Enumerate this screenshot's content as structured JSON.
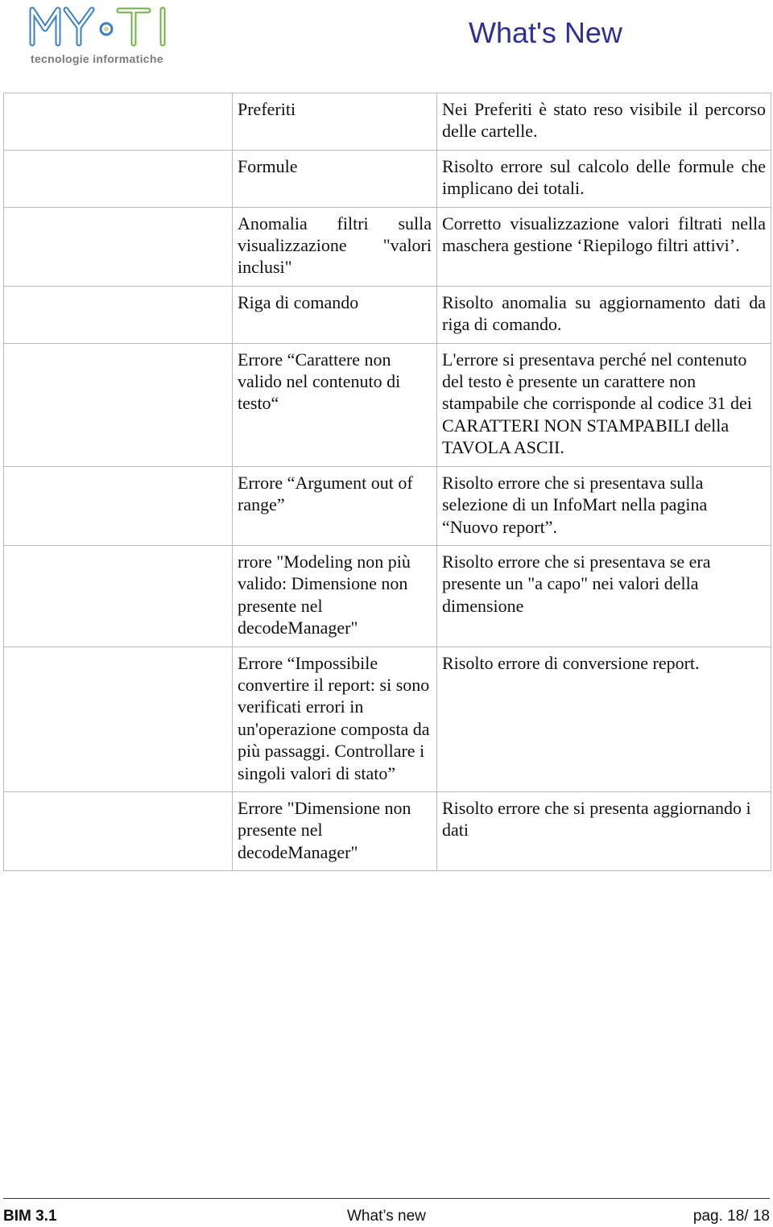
{
  "header": {
    "logo_text_left": "MY",
    "logo_text_right": "TI",
    "logo_subtitle": "tecnologie informatiche",
    "title": "What's New",
    "title_color": "#2e3192",
    "logo_blue": "#3a7fc4",
    "logo_green": "#6db33f"
  },
  "table": {
    "rows": [
      {
        "category": "",
        "issue": "Preferiti",
        "resolution": "Nei Preferiti è stato reso visibile il percorso delle cartelle.",
        "justify": true
      },
      {
        "category": "",
        "issue": "Formule",
        "resolution": "Risolto errore sul calcolo delle formule che implicano dei totali.",
        "justify": true
      },
      {
        "category": "",
        "issue": "Anomalia filtri sulla visualizzazione \"valori inclusi\"",
        "resolution": "Corretto visualizzazione valori filtrati nella maschera gestione ‘Riepilogo filtri attivi’.",
        "justify": true
      },
      {
        "category": "",
        "issue": "Riga di comando",
        "resolution": "Risolto anomalia su aggiornamento dati da riga di comando.",
        "justify": true
      },
      {
        "category": "",
        "issue": "Errore “Carattere non valido nel contenuto di testo“",
        "resolution": "L'errore si presentava perché nel contenuto del testo è presente un carattere non stampabile che corrisponde al codice 31 dei CARATTERI NON STAMPABILI della TAVOLA ASCII.",
        "justify": false
      },
      {
        "category": "",
        "issue": "Errore “Argument out of range”",
        "resolution": "Risolto errore che si presentava sulla selezione di un InfoMart nella pagina “Nuovo report”.",
        "justify": false
      },
      {
        "category": "",
        "issue": "rrore \"Modeling non più valido: Dimensione non presente nel decodeManager\"",
        "resolution": "Risolto errore che si presentava se era presente un \"a capo\" nei valori della dimensione",
        "justify": false
      },
      {
        "category": "",
        "issue": "Errore “Impossibile convertire il report: si sono verificati errori in un'operazione composta da più passaggi. Controllare i singoli valori di stato”",
        "resolution": "Risolto errore di conversione report.",
        "justify": false
      },
      {
        "category": "",
        "issue": "Errore \"Dimensione non presente nel decodeManager\"",
        "resolution": "Risolto errore che si presenta aggiornando i dati",
        "justify": false
      }
    ]
  },
  "footer": {
    "product": "BIM 3.1",
    "section": "What’s new",
    "page": "pag. 18/ 18"
  }
}
